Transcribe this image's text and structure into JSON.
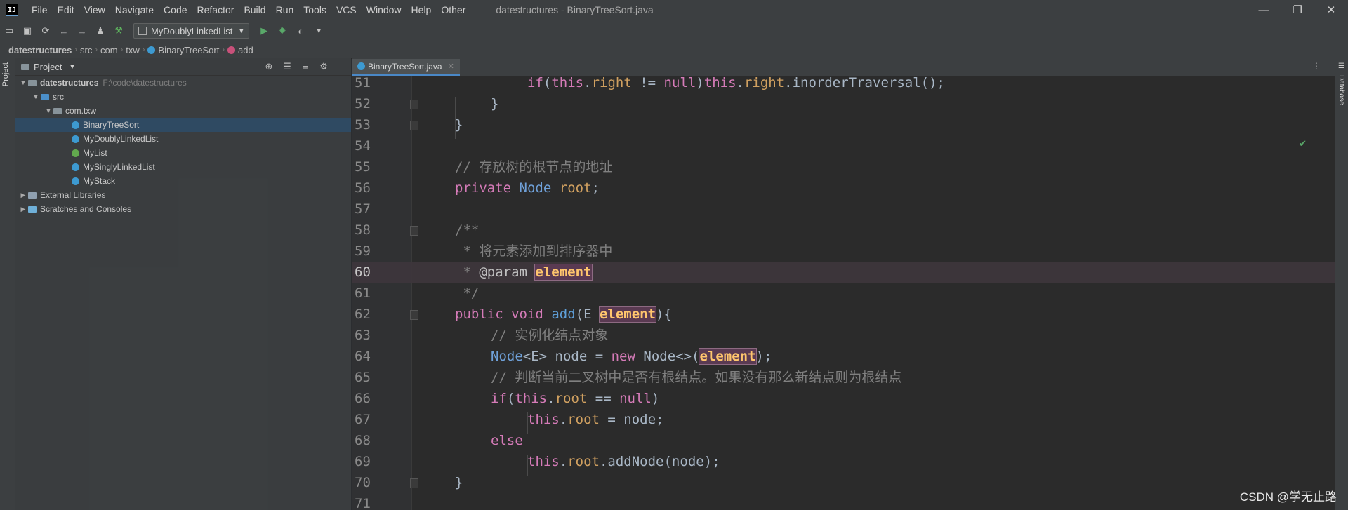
{
  "menubar": {
    "logo": "IJ",
    "items": [
      "File",
      "Edit",
      "View",
      "Navigate",
      "Code",
      "Refactor",
      "Build",
      "Run",
      "Tools",
      "VCS",
      "Window",
      "Help",
      "Other"
    ],
    "window_title": "datestructures - BinaryTreeSort.java",
    "controls": [
      "—",
      "❐",
      "✕"
    ]
  },
  "toolbar": {
    "run_config": "MyDoublyLinkedList",
    "icons": [
      "open-icon",
      "save-icon",
      "sync-icon",
      "back-icon",
      "forward-icon",
      "user-icon",
      "build-icon"
    ]
  },
  "breadcrumb": [
    "datestructures",
    "src",
    "com",
    "txw",
    "BinaryTreeSort",
    "add"
  ],
  "project": {
    "header": "Project",
    "root": {
      "name": "datestructures",
      "path": "F:\\code\\datestructures"
    },
    "src": "src",
    "package": "com.txw",
    "files": [
      "BinaryTreeSort",
      "MyDoublyLinkedList",
      "MyList",
      "MySinglyLinkedList",
      "MyStack"
    ],
    "external": "External Libraries",
    "scratches": "Scratches and Consoles"
  },
  "left_strip": {
    "tab": "Project"
  },
  "right_strip": {
    "tab": "Database"
  },
  "editor": {
    "tab": "BinaryTreeSort.java",
    "lines": [
      {
        "n": "51",
        "text": "if(this.right != null)this.right.inorderTraversal();"
      },
      {
        "n": "52",
        "text": "}"
      },
      {
        "n": "53",
        "text": "}"
      },
      {
        "n": "54",
        "text": ""
      },
      {
        "n": "55",
        "text": "// 存放树的根节点的地址"
      },
      {
        "n": "56",
        "text": "private Node root;"
      },
      {
        "n": "57",
        "text": ""
      },
      {
        "n": "58",
        "text": "/**"
      },
      {
        "n": "59",
        "text": " * 将元素添加到排序器中"
      },
      {
        "n": "60",
        "text": " * @param element"
      },
      {
        "n": "61",
        "text": " */"
      },
      {
        "n": "62",
        "text": "public void add(E element){"
      },
      {
        "n": "63",
        "text": "// 实例化结点对象"
      },
      {
        "n": "64",
        "text": "Node<E> node = new Node<>(element);"
      },
      {
        "n": "65",
        "text": "// 判断当前二叉树中是否有根结点。如果没有那么新结点则为根结点"
      },
      {
        "n": "66",
        "text": "if(this.root == null)"
      },
      {
        "n": "67",
        "text": "this.root = node;"
      },
      {
        "n": "68",
        "text": "else"
      },
      {
        "n": "69",
        "text": "this.root.addNode(node);"
      },
      {
        "n": "70",
        "text": "}"
      },
      {
        "n": "71",
        "text": ""
      }
    ]
  },
  "watermark": "CSDN @学无止路"
}
